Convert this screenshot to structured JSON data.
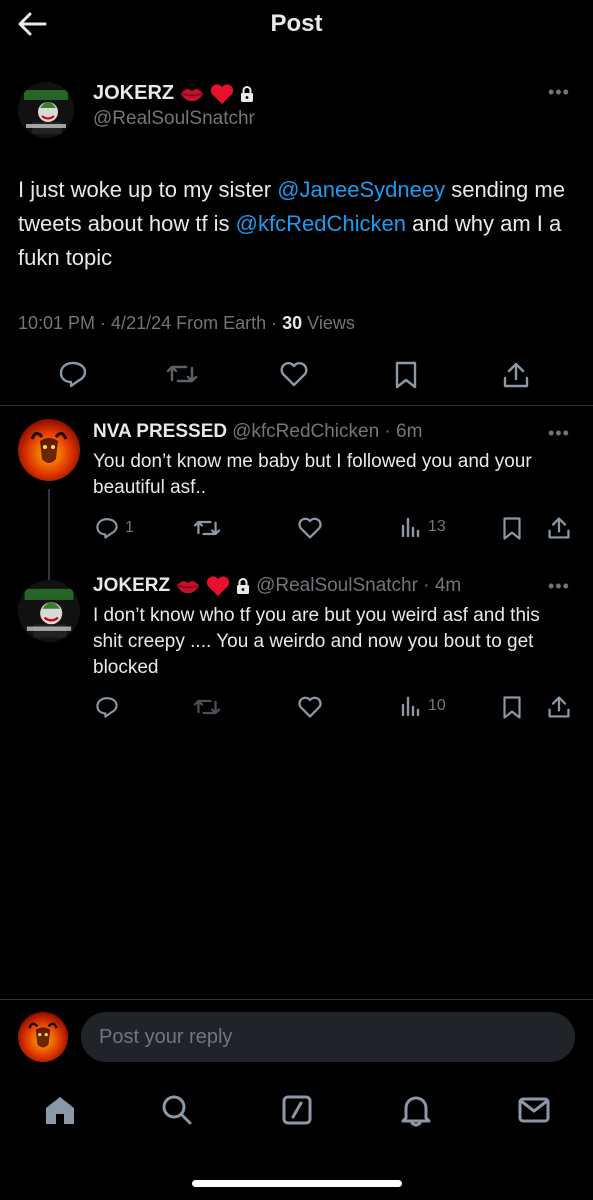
{
  "header": {
    "title": "Post"
  },
  "main_post": {
    "name": "JOKERZ",
    "handle": "@RealSoulSnatchr",
    "text_1": "I just woke up to my sister ",
    "mention_1": "@JaneeSydneey",
    "text_2": " sending me tweets about how tf is ",
    "mention_2": "@kfcRedChicken",
    "text_3": " and why am I a fukn topic",
    "meta_prefix": "10:01 PM · 4/21/24 From Earth · ",
    "views_count": "30",
    "views_label": " Views"
  },
  "replies": [
    {
      "name": "NVA PRESSED",
      "handle_time": "@kfcRedChicken · 6m",
      "text": "You don’t know me baby but I followed you and your beautiful asf..",
      "reply_count": "1",
      "views": "13"
    },
    {
      "name": "JOKERZ",
      "handle_time": "@RealSoulSnatchr · 4m",
      "text": "I don’t know who tf you are but you weird asf and this shit creepy .... You a weirdo and now you bout to get blocked",
      "reply_count": "",
      "views": "10"
    }
  ],
  "composer": {
    "placeholder": "Post your reply"
  },
  "colors": {
    "background": "#000000",
    "text": "#e7e9ea",
    "muted": "#71767b",
    "link": "#1d9bf0",
    "heart": "#f91880"
  },
  "icons": [
    "back-arrow-icon",
    "more-icon",
    "lock-icon",
    "lips-icon",
    "heart-emoji-icon",
    "reply-icon",
    "repost-icon",
    "like-icon",
    "bookmark-icon",
    "share-icon",
    "views-icon",
    "home-icon",
    "search-icon",
    "compose-icon",
    "notifications-icon",
    "messages-icon"
  ]
}
